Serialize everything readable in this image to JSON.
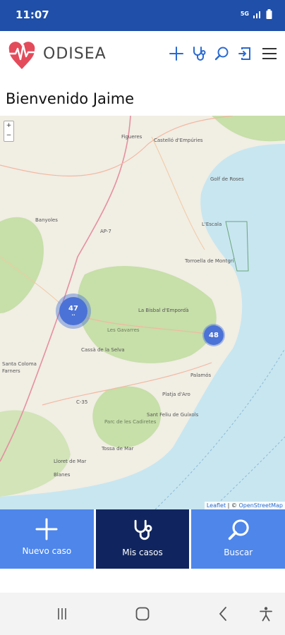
{
  "status_bar": {
    "time": "11:07",
    "network": "5G",
    "icons": [
      "network-5g-icon",
      "signal-icon",
      "battery-icon"
    ]
  },
  "app_bar": {
    "brand": "ODISEA",
    "brand_color": "#e34b5b",
    "icon_color": "#2a6ad0",
    "tools": [
      "add-icon",
      "stethoscope-icon",
      "search-icon",
      "logout-icon",
      "menu-icon"
    ]
  },
  "welcome": "Bienvenido Jaime",
  "map": {
    "zoom_in": "+",
    "zoom_out": "−",
    "clusters": [
      {
        "count": "47",
        "sub": "··"
      },
      {
        "count": "48",
        "sub": ""
      }
    ],
    "place_labels": [
      "Figueres",
      "Castelló d'Empúries",
      "Banyoles",
      "AP-7",
      "Torroella de Montgrí",
      "La Bisbal d'Empordà",
      "Les Gavarres",
      "Cassà de la Selva",
      "Palamós",
      "Platja d'Aro",
      "Sant Feliu de Guíxols",
      "Tossa de Mar",
      "Lloret de Mar",
      "Blanes",
      "Parc de les Cadiretes",
      "C-35",
      "Farners",
      "Santa Coloma",
      "L'Escala",
      "Golf de Roses"
    ],
    "attribution_leaflet": "Leaflet",
    "attribution_sep": " | © ",
    "attribution_osm": "OpenStreetMap"
  },
  "actions": [
    {
      "label": "Nuevo caso",
      "icon": "plus-icon",
      "active": false
    },
    {
      "label": "Mis casos",
      "icon": "stethoscope-icon",
      "active": true
    },
    {
      "label": "Buscar",
      "icon": "search-icon",
      "active": false
    }
  ],
  "colors": {
    "status_bar": "#1f4fa8",
    "action_button": "#4e86ea",
    "action_active": "#10255f",
    "cluster": "#4b72d6",
    "water": "#c8e6f0",
    "land": "#f1eee4",
    "forest": "#c7dfa9"
  }
}
